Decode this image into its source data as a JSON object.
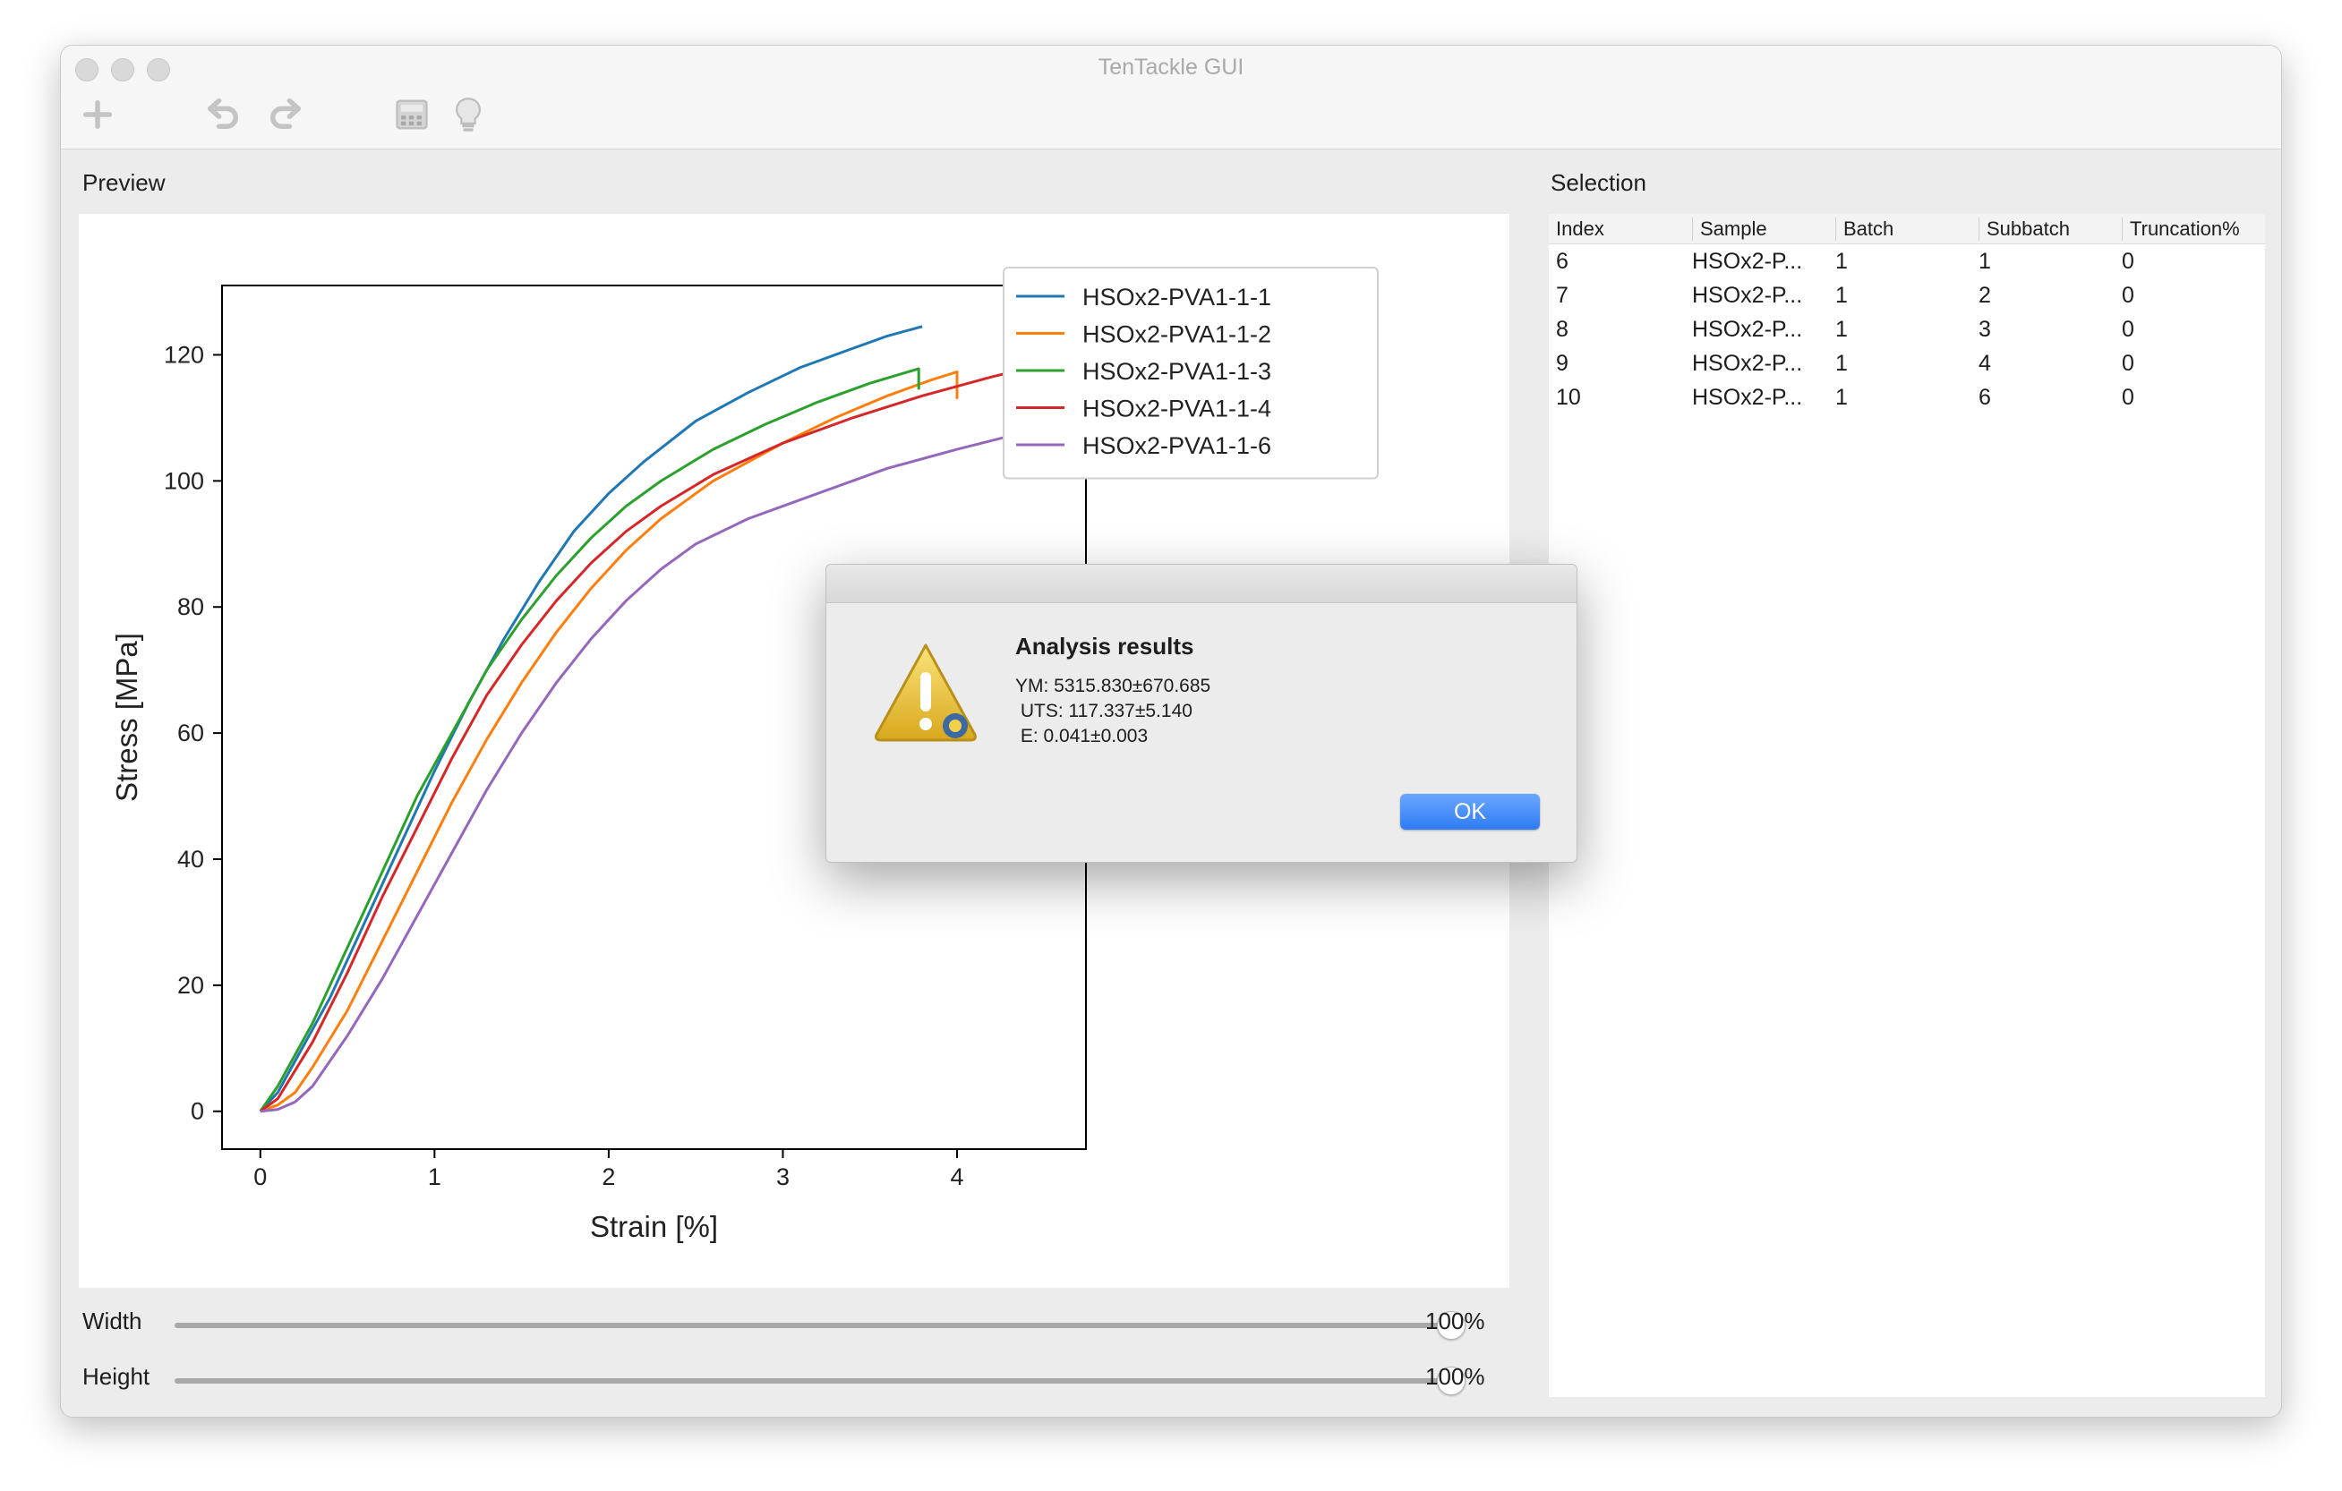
{
  "window": {
    "title": "TenTackle GUI"
  },
  "toolbar": {
    "icons": [
      "plus-icon",
      "undo-icon",
      "redo-icon",
      "calculator-icon",
      "lightbulb-icon"
    ]
  },
  "preview": {
    "label": "Preview",
    "width_label": "Width",
    "width_value": "100%",
    "width_level": 1.0,
    "height_label": "Height",
    "height_value": "100%",
    "height_level": 1.0
  },
  "selection": {
    "label": "Selection",
    "columns": [
      "Index",
      "Sample",
      "Batch",
      "Subbatch",
      "Truncation%"
    ],
    "rows": [
      [
        "6",
        "HSOx2-P...",
        "1",
        "1",
        "0"
      ],
      [
        "7",
        "HSOx2-P...",
        "1",
        "2",
        "0"
      ],
      [
        "8",
        "HSOx2-P...",
        "1",
        "3",
        "0"
      ],
      [
        "9",
        "HSOx2-P...",
        "1",
        "4",
        "0"
      ],
      [
        "10",
        "HSOx2-P...",
        "1",
        "6",
        "0"
      ]
    ]
  },
  "dialog": {
    "title": "Analysis results",
    "lines": [
      "YM: 5315.830±670.685",
      " UTS: 117.337±5.140",
      " E: 0.041±0.003"
    ],
    "ok_label": "OK"
  },
  "chart_data": {
    "type": "line",
    "xlabel": "Strain [%]",
    "ylabel": "Stress [MPa]",
    "xlim": [
      -0.22,
      4.74
    ],
    "ylim": [
      -6,
      131
    ],
    "xticks": [
      0,
      1,
      2,
      3,
      4
    ],
    "yticks": [
      0,
      20,
      40,
      60,
      80,
      100,
      120
    ],
    "legend": "top-right outside",
    "grid": false,
    "series": [
      {
        "name": "HSOx2-PVA1-1-1",
        "color": "#1f77b4",
        "points": [
          [
            0,
            0
          ],
          [
            0.1,
            3
          ],
          [
            0.2,
            8
          ],
          [
            0.4,
            18
          ],
          [
            0.6,
            30
          ],
          [
            0.8,
            42
          ],
          [
            1.0,
            54
          ],
          [
            1.2,
            65
          ],
          [
            1.4,
            75
          ],
          [
            1.6,
            84
          ],
          [
            1.8,
            92
          ],
          [
            2.0,
            98
          ],
          [
            2.2,
            103
          ],
          [
            2.5,
            109.5
          ],
          [
            2.8,
            114
          ],
          [
            3.1,
            118
          ],
          [
            3.4,
            121
          ],
          [
            3.6,
            123
          ],
          [
            3.8,
            124.5
          ]
        ]
      },
      {
        "name": "HSOx2-PVA1-1-2",
        "color": "#ff7f0e",
        "points": [
          [
            0,
            0
          ],
          [
            0.1,
            1
          ],
          [
            0.2,
            3
          ],
          [
            0.3,
            7
          ],
          [
            0.5,
            16
          ],
          [
            0.7,
            27
          ],
          [
            0.9,
            38
          ],
          [
            1.1,
            49
          ],
          [
            1.3,
            59
          ],
          [
            1.5,
            68
          ],
          [
            1.7,
            76
          ],
          [
            1.9,
            83
          ],
          [
            2.1,
            89
          ],
          [
            2.3,
            94
          ],
          [
            2.6,
            100
          ],
          [
            3.0,
            106
          ],
          [
            3.3,
            110
          ],
          [
            3.6,
            113.5
          ],
          [
            3.85,
            116
          ],
          [
            4.0,
            117.3
          ],
          [
            4.0,
            113
          ]
        ]
      },
      {
        "name": "HSOx2-PVA1-1-3",
        "color": "#2ca02c",
        "points": [
          [
            0,
            0
          ],
          [
            0.1,
            4
          ],
          [
            0.3,
            14
          ],
          [
            0.5,
            26
          ],
          [
            0.7,
            38
          ],
          [
            0.9,
            50
          ],
          [
            1.1,
            60
          ],
          [
            1.3,
            70
          ],
          [
            1.5,
            78
          ],
          [
            1.7,
            85
          ],
          [
            1.9,
            91
          ],
          [
            2.1,
            96
          ],
          [
            2.3,
            100
          ],
          [
            2.6,
            105
          ],
          [
            2.9,
            109
          ],
          [
            3.2,
            112.5
          ],
          [
            3.5,
            115.5
          ],
          [
            3.78,
            117.8
          ],
          [
            3.78,
            114.5
          ]
        ]
      },
      {
        "name": "HSOx2-PVA1-1-4",
        "color": "#d62728",
        "points": [
          [
            0,
            0
          ],
          [
            0.1,
            2
          ],
          [
            0.3,
            11
          ],
          [
            0.5,
            22
          ],
          [
            0.7,
            34
          ],
          [
            0.9,
            45
          ],
          [
            1.1,
            56
          ],
          [
            1.3,
            66
          ],
          [
            1.5,
            74
          ],
          [
            1.7,
            81
          ],
          [
            1.9,
            87
          ],
          [
            2.1,
            92
          ],
          [
            2.3,
            96
          ],
          [
            2.6,
            101
          ],
          [
            3.0,
            106
          ],
          [
            3.4,
            110
          ],
          [
            3.8,
            113.5
          ],
          [
            4.2,
            116.5
          ],
          [
            4.5,
            118.5
          ],
          [
            4.52,
            114
          ]
        ]
      },
      {
        "name": "HSOx2-PVA1-1-6",
        "color": "#9467bd",
        "points": [
          [
            0,
            0
          ],
          [
            0.1,
            0.3
          ],
          [
            0.2,
            1.5
          ],
          [
            0.3,
            4
          ],
          [
            0.5,
            12
          ],
          [
            0.7,
            21
          ],
          [
            0.9,
            31
          ],
          [
            1.1,
            41
          ],
          [
            1.3,
            51
          ],
          [
            1.5,
            60
          ],
          [
            1.7,
            68
          ],
          [
            1.9,
            75
          ],
          [
            2.1,
            81
          ],
          [
            2.3,
            86
          ],
          [
            2.5,
            90
          ],
          [
            2.8,
            94
          ],
          [
            3.2,
            98
          ],
          [
            3.6,
            102
          ],
          [
            4.0,
            105
          ],
          [
            4.5,
            108.5
          ]
        ]
      }
    ]
  }
}
